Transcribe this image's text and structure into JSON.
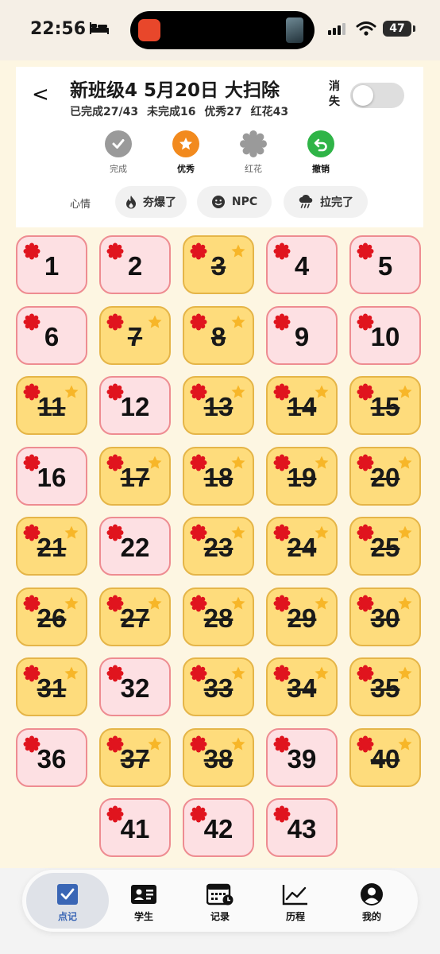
{
  "status_bar": {
    "time": "22:56",
    "battery": "47"
  },
  "header": {
    "back_label": "<",
    "title": "新班级4  5月20日 大扫除",
    "stats": [
      "已完成27/43",
      "未完成16",
      "优秀27",
      "红花43"
    ],
    "clear_label": "消失",
    "clear_toggle_on": false
  },
  "actions": [
    {
      "label": "完成",
      "icon": "check-icon"
    },
    {
      "label": "优秀",
      "icon": "star-icon"
    },
    {
      "label": "红花",
      "icon": "flower-icon"
    },
    {
      "label": "撤销",
      "icon": "undo-icon"
    }
  ],
  "mood": {
    "title": "心情",
    "options": [
      {
        "label": "夯爆了",
        "icon": "fire-icon"
      },
      {
        "label": "NPC",
        "icon": "smile-icon"
      },
      {
        "label": "拉完了",
        "icon": "rain-icon"
      }
    ]
  },
  "students": [
    {
      "n": "1",
      "done": false
    },
    {
      "n": "2",
      "done": false
    },
    {
      "n": "3",
      "done": true
    },
    {
      "n": "4",
      "done": false
    },
    {
      "n": "5",
      "done": false
    },
    {
      "n": "6",
      "done": false
    },
    {
      "n": "7",
      "done": true
    },
    {
      "n": "8",
      "done": true
    },
    {
      "n": "9",
      "done": false
    },
    {
      "n": "10",
      "done": false
    },
    {
      "n": "11",
      "done": true
    },
    {
      "n": "12",
      "done": false
    },
    {
      "n": "13",
      "done": true
    },
    {
      "n": "14",
      "done": true
    },
    {
      "n": "15",
      "done": true
    },
    {
      "n": "16",
      "done": false
    },
    {
      "n": "17",
      "done": true
    },
    {
      "n": "18",
      "done": true
    },
    {
      "n": "19",
      "done": true
    },
    {
      "n": "20",
      "done": true
    },
    {
      "n": "21",
      "done": true
    },
    {
      "n": "22",
      "done": false
    },
    {
      "n": "23",
      "done": true
    },
    {
      "n": "24",
      "done": true
    },
    {
      "n": "25",
      "done": true
    },
    {
      "n": "26",
      "done": true
    },
    {
      "n": "27",
      "done": true
    },
    {
      "n": "28",
      "done": true
    },
    {
      "n": "29",
      "done": true
    },
    {
      "n": "30",
      "done": true
    },
    {
      "n": "31",
      "done": true
    },
    {
      "n": "32",
      "done": false
    },
    {
      "n": "33",
      "done": true
    },
    {
      "n": "34",
      "done": true
    },
    {
      "n": "35",
      "done": true
    },
    {
      "n": "36",
      "done": false
    },
    {
      "n": "37",
      "done": true
    },
    {
      "n": "38",
      "done": true
    },
    {
      "n": "39",
      "done": false
    },
    {
      "n": "40",
      "done": true
    },
    {
      "n": "41",
      "done": false
    },
    {
      "n": "42",
      "done": false
    },
    {
      "n": "43",
      "done": false
    }
  ],
  "tabs": [
    {
      "label": "点记",
      "icon": "checkbox-icon",
      "active": true
    },
    {
      "label": "学生",
      "icon": "id-card-icon",
      "active": false
    },
    {
      "label": "记录",
      "icon": "calendar-icon",
      "active": false
    },
    {
      "label": "历程",
      "icon": "chart-icon",
      "active": false
    },
    {
      "label": "我的",
      "icon": "person-icon",
      "active": false
    }
  ],
  "colors": {
    "background": "#fdf6e2",
    "pending_cell": "#fde0e3",
    "done_cell": "#fedc7c",
    "flower": "#e0141e",
    "star": "#f7b628",
    "excellent": "#f28a1e",
    "undo": "#2fb447",
    "tab_active": "#3a66b5"
  }
}
